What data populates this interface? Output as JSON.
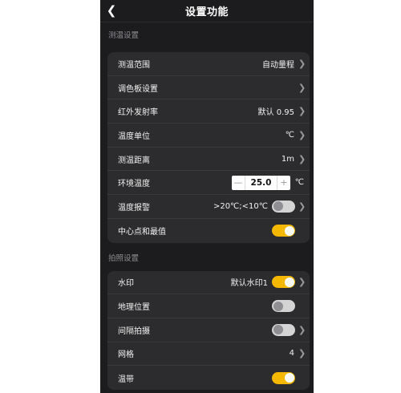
{
  "header": {
    "title": "设置功能",
    "back_icon": "chevron-left-icon"
  },
  "section1": {
    "label": "测温设置",
    "rows": [
      {
        "label": "测温范围",
        "value": "自动量程"
      },
      {
        "label": "调色板设置"
      },
      {
        "label": "红外发射率",
        "value": "默认 0.95"
      },
      {
        "label": "温度单位",
        "value": "℃"
      },
      {
        "label": "测温距离",
        "value": "1m"
      },
      {
        "label": "环境温度",
        "value": "25.0",
        "minus": "—",
        "plus": "+",
        "unit": "℃"
      },
      {
        "label": "温度报警",
        "value": ">20℃;<10℃",
        "toggle": "off"
      },
      {
        "label": "中心点和最值",
        "toggle": "on"
      }
    ]
  },
  "section2": {
    "label": "拍照设置",
    "rows": [
      {
        "label": "水印",
        "value": "默认水印1",
        "toggle": "on"
      },
      {
        "label": "地理位置",
        "toggle": "off"
      },
      {
        "label": "间隔拍摄",
        "toggle": "off"
      },
      {
        "label": "网格",
        "value": "4"
      },
      {
        "label": "温带",
        "toggle": "on"
      }
    ]
  },
  "colors": {
    "accent": "#f5b800",
    "background": "#1c1c1e",
    "card": "#2c2c2e"
  }
}
